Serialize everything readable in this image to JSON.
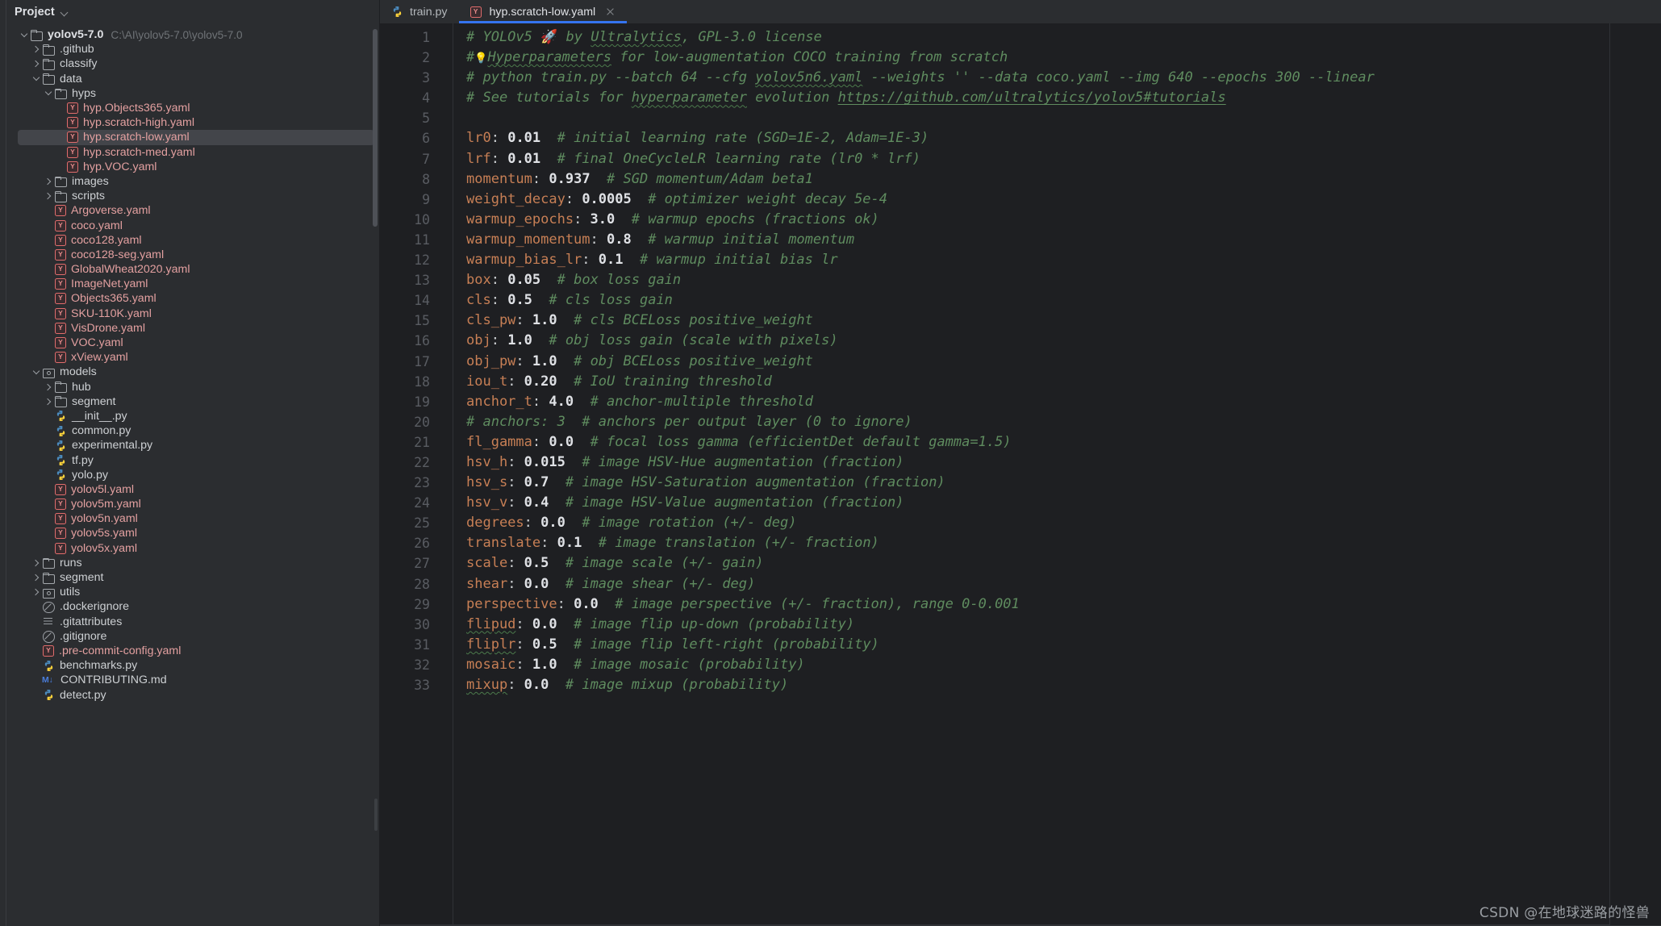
{
  "project_panel": {
    "title": "Project",
    "dropdown_icon": "chevron-down-icon",
    "root": {
      "label": "yolov5-7.0",
      "path": "C:\\AI\\yolov5-7.0\\yolov5-7.0"
    },
    "items": [
      {
        "label": "yolov5-7.0",
        "path": "C:\\AI\\yolov5-7.0\\yolov5-7.0",
        "indent": 0,
        "arrow": "open",
        "icon": "folder",
        "bold": true
      },
      {
        "label": ".github",
        "indent": 1,
        "arrow": "closed",
        "icon": "folder"
      },
      {
        "label": "classify",
        "indent": 1,
        "arrow": "closed",
        "icon": "folder"
      },
      {
        "label": "data",
        "indent": 1,
        "arrow": "open",
        "icon": "folder"
      },
      {
        "label": "hyps",
        "indent": 2,
        "arrow": "open",
        "icon": "folder"
      },
      {
        "label": "hyp.Objects365.yaml",
        "indent": 3,
        "icon": "yaml"
      },
      {
        "label": "hyp.scratch-high.yaml",
        "indent": 3,
        "icon": "yaml"
      },
      {
        "label": "hyp.scratch-low.yaml",
        "indent": 3,
        "icon": "yaml",
        "selected": true
      },
      {
        "label": "hyp.scratch-med.yaml",
        "indent": 3,
        "icon": "yaml"
      },
      {
        "label": "hyp.VOC.yaml",
        "indent": 3,
        "icon": "yaml"
      },
      {
        "label": "images",
        "indent": 2,
        "arrow": "closed",
        "icon": "folder"
      },
      {
        "label": "scripts",
        "indent": 2,
        "arrow": "closed",
        "icon": "folder"
      },
      {
        "label": "Argoverse.yaml",
        "indent": 2,
        "icon": "yaml"
      },
      {
        "label": "coco.yaml",
        "indent": 2,
        "icon": "yaml"
      },
      {
        "label": "coco128.yaml",
        "indent": 2,
        "icon": "yaml"
      },
      {
        "label": "coco128-seg.yaml",
        "indent": 2,
        "icon": "yaml"
      },
      {
        "label": "GlobalWheat2020.yaml",
        "indent": 2,
        "icon": "yaml"
      },
      {
        "label": "ImageNet.yaml",
        "indent": 2,
        "icon": "yaml"
      },
      {
        "label": "Objects365.yaml",
        "indent": 2,
        "icon": "yaml"
      },
      {
        "label": "SKU-110K.yaml",
        "indent": 2,
        "icon": "yaml"
      },
      {
        "label": "VisDrone.yaml",
        "indent": 2,
        "icon": "yaml"
      },
      {
        "label": "VOC.yaml",
        "indent": 2,
        "icon": "yaml"
      },
      {
        "label": "xView.yaml",
        "indent": 2,
        "icon": "yaml"
      },
      {
        "label": "models",
        "indent": 1,
        "arrow": "open",
        "icon": "modfolder"
      },
      {
        "label": "hub",
        "indent": 2,
        "arrow": "closed",
        "icon": "folder"
      },
      {
        "label": "segment",
        "indent": 2,
        "arrow": "closed",
        "icon": "folder"
      },
      {
        "label": "__init__.py",
        "indent": 2,
        "icon": "py"
      },
      {
        "label": "common.py",
        "indent": 2,
        "icon": "py"
      },
      {
        "label": "experimental.py",
        "indent": 2,
        "icon": "py"
      },
      {
        "label": "tf.py",
        "indent": 2,
        "icon": "py"
      },
      {
        "label": "yolo.py",
        "indent": 2,
        "icon": "py"
      },
      {
        "label": "yolov5l.yaml",
        "indent": 2,
        "icon": "yaml"
      },
      {
        "label": "yolov5m.yaml",
        "indent": 2,
        "icon": "yaml"
      },
      {
        "label": "yolov5n.yaml",
        "indent": 2,
        "icon": "yaml"
      },
      {
        "label": "yolov5s.yaml",
        "indent": 2,
        "icon": "yaml"
      },
      {
        "label": "yolov5x.yaml",
        "indent": 2,
        "icon": "yaml"
      },
      {
        "label": "runs",
        "indent": 1,
        "arrow": "closed",
        "icon": "folder"
      },
      {
        "label": "segment",
        "indent": 1,
        "arrow": "closed",
        "icon": "folder"
      },
      {
        "label": "utils",
        "indent": 1,
        "arrow": "closed",
        "icon": "modfolder"
      },
      {
        "label": ".dockerignore",
        "indent": 1,
        "icon": "ignore"
      },
      {
        "label": ".gitattributes",
        "indent": 1,
        "icon": "lines"
      },
      {
        "label": ".gitignore",
        "indent": 1,
        "icon": "ignore"
      },
      {
        "label": ".pre-commit-config.yaml",
        "indent": 1,
        "icon": "yaml"
      },
      {
        "label": "benchmarks.py",
        "indent": 1,
        "icon": "py"
      },
      {
        "label": "CONTRIBUTING.md",
        "indent": 1,
        "icon": "markdown"
      },
      {
        "label": "detect.py",
        "indent": 1,
        "icon": "py"
      }
    ]
  },
  "tabs": [
    {
      "label": "train.py",
      "icon": "python-icon",
      "active": false,
      "closable": false
    },
    {
      "label": "hyp.scratch-low.yaml",
      "icon": "yaml-icon",
      "active": true,
      "closable": true
    }
  ],
  "editor": {
    "filename": "hyp.scratch-low.yaml",
    "first_line": 1,
    "last_line": 33,
    "line_numbers": [
      1,
      2,
      3,
      4,
      5,
      6,
      7,
      8,
      9,
      10,
      11,
      12,
      13,
      14,
      15,
      16,
      17,
      18,
      19,
      20,
      21,
      22,
      23,
      24,
      25,
      26,
      27,
      28,
      29,
      30,
      31,
      32,
      33
    ],
    "lines": [
      {
        "n": 1,
        "type": "comment",
        "text": "# YOLOv5 🚀 by Ultralytics, GPL-3.0 license"
      },
      {
        "n": 2,
        "type": "comment",
        "text": "# Hyperparameters for low-augmentation COCO training from scratch"
      },
      {
        "n": 3,
        "type": "comment",
        "text": "# python train.py --batch 64 --cfg yolov5n6.yaml --weights '' --data coco.yaml --img 640 --epochs 300 --linear"
      },
      {
        "n": 4,
        "type": "comment",
        "text": "# See tutorials for hyperparameter evolution https://github.com/ultralytics/yolov5#tutorials"
      },
      {
        "n": 5,
        "type": "blank",
        "text": ""
      },
      {
        "n": 6,
        "type": "pair",
        "key": "lr0",
        "value": "0.01",
        "comment": "# initial learning rate (SGD=1E-2, Adam=1E-3)"
      },
      {
        "n": 7,
        "type": "pair",
        "key": "lrf",
        "value": "0.01",
        "comment": "# final OneCycleLR learning rate (lr0 * lrf)"
      },
      {
        "n": 8,
        "type": "pair",
        "key": "momentum",
        "value": "0.937",
        "comment": "# SGD momentum/Adam beta1"
      },
      {
        "n": 9,
        "type": "pair",
        "key": "weight_decay",
        "value": "0.0005",
        "comment": "# optimizer weight decay 5e-4"
      },
      {
        "n": 10,
        "type": "pair",
        "key": "warmup_epochs",
        "value": "3.0",
        "comment": "# warmup epochs (fractions ok)"
      },
      {
        "n": 11,
        "type": "pair",
        "key": "warmup_momentum",
        "value": "0.8",
        "comment": "# warmup initial momentum"
      },
      {
        "n": 12,
        "type": "pair",
        "key": "warmup_bias_lr",
        "value": "0.1",
        "comment": "# warmup initial bias lr"
      },
      {
        "n": 13,
        "type": "pair",
        "key": "box",
        "value": "0.05",
        "comment": "# box loss gain"
      },
      {
        "n": 14,
        "type": "pair",
        "key": "cls",
        "value": "0.5",
        "comment": "# cls loss gain"
      },
      {
        "n": 15,
        "type": "pair",
        "key": "cls_pw",
        "value": "1.0",
        "comment": "# cls BCELoss positive_weight"
      },
      {
        "n": 16,
        "type": "pair",
        "key": "obj",
        "value": "1.0",
        "comment": "# obj loss gain (scale with pixels)"
      },
      {
        "n": 17,
        "type": "pair",
        "key": "obj_pw",
        "value": "1.0",
        "comment": "# obj BCELoss positive_weight"
      },
      {
        "n": 18,
        "type": "pair",
        "key": "iou_t",
        "value": "0.20",
        "comment": "# IoU training threshold"
      },
      {
        "n": 19,
        "type": "pair",
        "key": "anchor_t",
        "value": "4.0",
        "comment": "# anchor-multiple threshold"
      },
      {
        "n": 20,
        "type": "comment",
        "text": "# anchors: 3  # anchors per output layer (0 to ignore)"
      },
      {
        "n": 21,
        "type": "pair",
        "key": "fl_gamma",
        "value": "0.0",
        "comment": "# focal loss gamma (efficientDet default gamma=1.5)"
      },
      {
        "n": 22,
        "type": "pair",
        "key": "hsv_h",
        "value": "0.015",
        "comment": "# image HSV-Hue augmentation (fraction)"
      },
      {
        "n": 23,
        "type": "pair",
        "key": "hsv_s",
        "value": "0.7",
        "comment": "# image HSV-Saturation augmentation (fraction)"
      },
      {
        "n": 24,
        "type": "pair",
        "key": "hsv_v",
        "value": "0.4",
        "comment": "# image HSV-Value augmentation (fraction)"
      },
      {
        "n": 25,
        "type": "pair",
        "key": "degrees",
        "value": "0.0",
        "comment": "# image rotation (+/- deg)"
      },
      {
        "n": 26,
        "type": "pair",
        "key": "translate",
        "value": "0.1",
        "comment": "# image translation (+/- fraction)"
      },
      {
        "n": 27,
        "type": "pair",
        "key": "scale",
        "value": "0.5",
        "comment": "# image scale (+/- gain)"
      },
      {
        "n": 28,
        "type": "pair",
        "key": "shear",
        "value": "0.0",
        "comment": "# image shear (+/- deg)"
      },
      {
        "n": 29,
        "type": "pair",
        "key": "perspective",
        "value": "0.0",
        "comment": "# image perspective (+/- fraction), range 0-0.001"
      },
      {
        "n": 30,
        "type": "pair",
        "key": "flipud",
        "value": "0.0",
        "comment": "# image flip up-down (probability)",
        "key_squiggly": true
      },
      {
        "n": 31,
        "type": "pair",
        "key": "fliplr",
        "value": "0.5",
        "comment": "# image flip left-right (probability)",
        "key_squiggly": true
      },
      {
        "n": 32,
        "type": "pair",
        "key": "mosaic",
        "value": "1.0",
        "comment": "# image mosaic (probability)"
      },
      {
        "n": 33,
        "type": "pair",
        "key": "mixup",
        "value": "0.0",
        "comment": "# image mixup (probability)",
        "key_squiggly": true
      }
    ]
  },
  "watermark": {
    "text": "CSDN @在地球迷路的怪兽"
  },
  "colors": {
    "panel_bg": "#2b2d30",
    "editor_bg": "#1e1f22",
    "selection": "#43454a",
    "accent": "#3574f0",
    "key": "#c77f55",
    "value": "#dfe1e5",
    "comment": "#5f8c5f",
    "yaml_icon": "#e06c6c",
    "line_number": "#595c62"
  }
}
